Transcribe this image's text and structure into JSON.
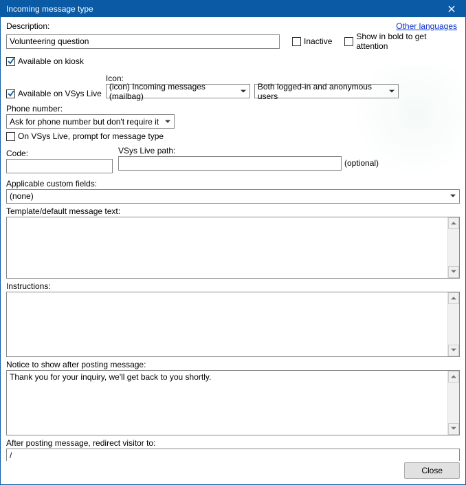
{
  "window": {
    "title": "Incoming message type",
    "close_button_label": "Close"
  },
  "link_other_languages": "Other languages",
  "labels": {
    "description": "Description:",
    "inactive": "Inactive",
    "show_bold": "Show in bold to get attention",
    "available_kiosk": "Available on kiosk",
    "available_vsys_live": "Available on VSys Live",
    "icon": "Icon:",
    "phone_number": "Phone number:",
    "prompt_message_type": "On VSys Live, prompt for message type",
    "code": "Code:",
    "vsys_live_path": "VSys Live path:",
    "optional": "(optional)",
    "applicable_custom_fields": "Applicable custom fields:",
    "template_text": "Template/default message text:",
    "instructions": "Instructions:",
    "notice_after_posting": "Notice to show after posting message:",
    "redirect_to": "After posting message, redirect visitor to:"
  },
  "values": {
    "description": "Volunteering question",
    "inactive": false,
    "show_bold": false,
    "available_kiosk": true,
    "available_vsys_live": true,
    "icon": "(icon) Incoming messages (mailbag)",
    "access_mode": "Both logged-in and anonymous users",
    "phone_number": "Ask for phone number but don't require it",
    "prompt_message_type": false,
    "code": "",
    "vsys_live_path": "",
    "applicable_custom_fields": "(none)",
    "template_text": "",
    "instructions": "",
    "notice_after_posting": "Thank you for your inquiry, we'll get back to you shortly.",
    "redirect_to": "/"
  },
  "buttons": {
    "close": "Close"
  }
}
